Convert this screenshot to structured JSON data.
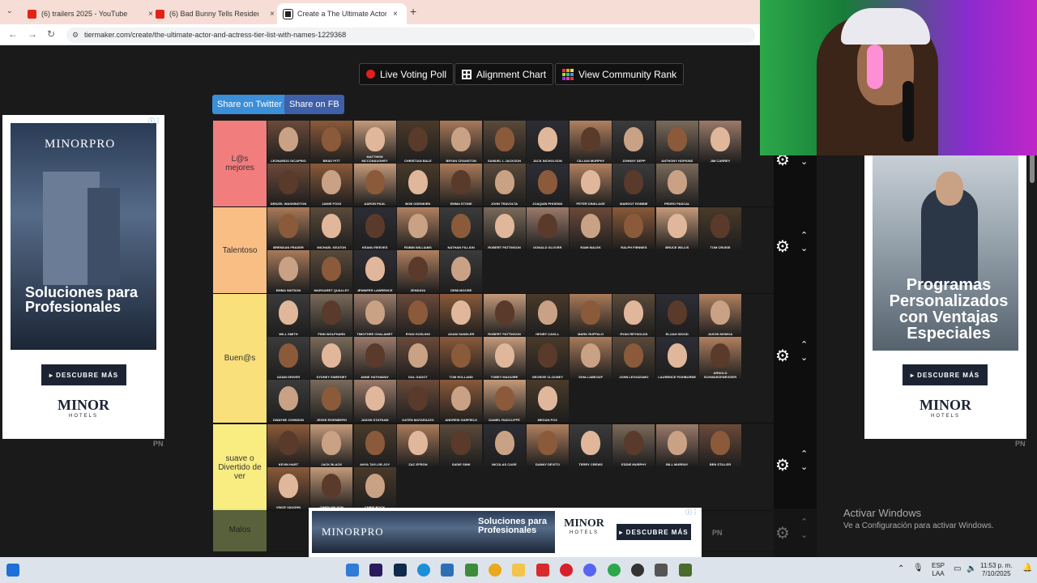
{
  "browser": {
    "tabs": [
      {
        "title": "(6) trailers 2025 - YouTube",
        "icon": "youtube-icon"
      },
      {
        "title": "(6) Bad Bunny Tells Residente W",
        "icon": "youtube-icon"
      },
      {
        "title": "Create a The Ultimate Actor and",
        "icon": "tiermaker-icon"
      }
    ],
    "url": "tiermaker.com/create/the-ultimate-actor-and-actress-tier-list-with-names-1229368",
    "new_tab": "+",
    "close": "×"
  },
  "toolbar": {
    "live_voting": "Live Voting Poll",
    "alignment": "Alignment Chart",
    "community": "View Community Rank",
    "share_twitter": "Share on Twitter",
    "share_fb": "Share on FB"
  },
  "tiers": [
    {
      "label": "L@s mejores",
      "color": "#f27d7d",
      "items": [
        "LEONARDO DICAPRIO",
        "BRAD PITT",
        "MATTHEW MCCONAUGHEY",
        "CHRISTIAN BALE",
        "BRYAN CRANSTON",
        "SAMUEL L JACKSON",
        "JACK NICHOLSON",
        "CILLIAN MURPHY",
        "JOHNNY DEPP",
        "ANTHONY HOPKINS",
        "JIM CARREY",
        "DENZEL WASHINGTON",
        "JAMIE FOXX",
        "AARON PAUL",
        "BOB ODENKIRK",
        "EMMA STONE",
        "JOHN TRAVOLTA",
        "JOAQUIN PHOENIX",
        "PETER DINKLAGE",
        "MARGOT ROBBIE",
        "PEDRO PASCAL"
      ]
    },
    {
      "label": "Talentoso",
      "color": "#f8be84",
      "items": [
        "BRENDAN FRASER",
        "MICHAEL KEATON",
        "KEANU REEVES",
        "ROBIN WILLIAMS",
        "NATHAN FILLION",
        "ROBERT PATTINSON",
        "DONALD GLOVER",
        "RAMI MALEK",
        "RALPH FIENNES",
        "BRUCE WILLIS",
        "TOM CRUISE",
        "EMMA WATSON",
        "MARGARET QUALLEY",
        "JENNIFER LAWRENCE",
        "ZENDAYA",
        "DEMI MOORE"
      ]
    },
    {
      "label": "Buen@s",
      "color": "#f9e07a",
      "items": [
        "WILL SMITH",
        "FINN WOLFHARD",
        "TIMOTHEE CHALAMET",
        "RYAN GOSLING",
        "ADAM SANDLER",
        "ROBERT PATTINSON",
        "HENRY CAVILL",
        "MARK RUFFALO",
        "RYAN REYNOLDS",
        "ELIJAH WOOD",
        "JASON MOMOA",
        "ADAM DRIVER",
        "SYDNEY SWEENEY",
        "ANNE HATHAWAY",
        "GAL GADOT",
        "TOM HOLLAND",
        "TOBEY MAGUIRE",
        "GEORGE CLOONEY",
        "SHIA LABEOUF",
        "JOHN LEGUIZAMO",
        "LAURENCE FISHBURNE",
        "ARNOLD SCHWARZENEGGER",
        "DWAYNE JOHNSON",
        "JESSE EISENBERG",
        "JASON STATHAM",
        "GATEN MATARAZZO",
        "ANDREW GARFIELD",
        "DANIEL RADCLIFFE",
        "MEGAN FOX"
      ]
    },
    {
      "label": "suave o Divertido de ver",
      "color": "#f9ed82",
      "items": [
        "KEVIN HART",
        "JACK BLACK",
        "ANYA TAYLOR-JOY",
        "ZAC EFRON",
        "SADIE SINK",
        "NICOLAS CAGE",
        "DANNY DEVITO",
        "TERRY CREWS",
        "EDDIE MURPHY",
        "BILL MURRAY",
        "BEN STILLER",
        "VINCE VAUGHN",
        "OWEN WILSON",
        "CHRIS ROCK"
      ]
    },
    {
      "label": "Malos",
      "color": "#cde67a",
      "items": []
    }
  ],
  "ads": {
    "left": {
      "logo": "MINORPRO",
      "tagline": "Soluciones para Profesionales",
      "button": "DESCUBRE MÁS",
      "brand": "MINOR",
      "brand_sub": "HOTELS"
    },
    "right": {
      "tagline": "Programas Personalizados con Ventajas Especiales",
      "button": "DESCUBRE MÁS",
      "brand": "MINOR",
      "brand_sub": "HOTELS"
    },
    "bottom": {
      "logo": "MINORPRO",
      "tagline": "Soluciones para Profesionales",
      "brand": "MINOR",
      "brand_sub": "HOTELS",
      "button": "DESCUBRE MÁS"
    },
    "pn": "PN"
  },
  "activate_windows": {
    "title": "Activar Windows",
    "sub": "Ve a Configuración para activar Windows."
  },
  "taskbar": {
    "lang": "ESP",
    "lang2": "LAA",
    "time": "11:53 p. m.",
    "date": "7/10/2025"
  }
}
